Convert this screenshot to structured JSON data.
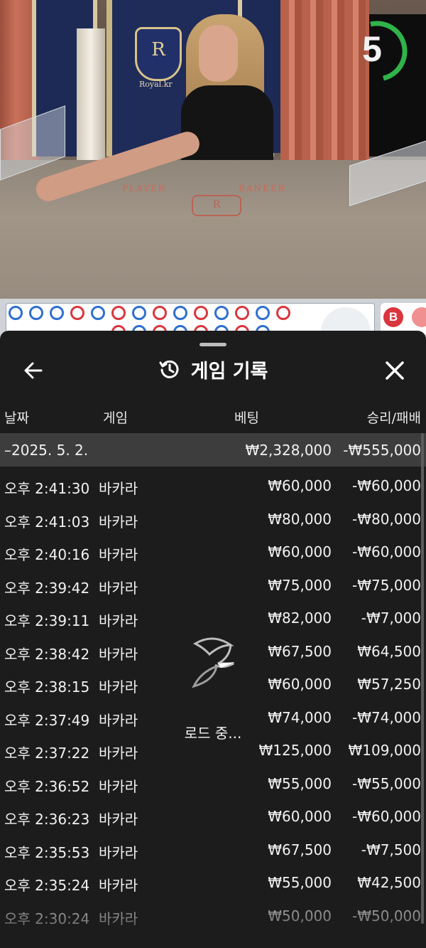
{
  "video": {
    "countdown": "5",
    "brand": "Royal.kr",
    "crest_letter": "R",
    "table_player": "PLAYER",
    "table_banker": "BANKER",
    "table_logo": "R"
  },
  "road": {
    "top_row": [
      "blue",
      "blue",
      "blue",
      "red",
      "blue",
      "red",
      "blue",
      "red",
      "blue",
      "red",
      "blue",
      "red",
      "blue",
      "red"
    ],
    "banker_badge": "B"
  },
  "sheet": {
    "title": "게임 기록",
    "columns": {
      "date": "날짜",
      "game": "게임",
      "bet": "베팅",
      "result": "승리/패배"
    },
    "date_row": {
      "date": "–2025. 5. 2.",
      "bet": "₩2,328,000",
      "result": "-₩555,000"
    },
    "rows": [
      {
        "time": "오후 2:41:30",
        "game": "바카라",
        "bet": "₩60,000",
        "result": "-₩60,000"
      },
      {
        "time": "오후 2:41:03",
        "game": "바카라",
        "bet": "₩80,000",
        "result": "-₩80,000"
      },
      {
        "time": "오후 2:40:16",
        "game": "바카라",
        "bet": "₩60,000",
        "result": "-₩60,000"
      },
      {
        "time": "오후 2:39:42",
        "game": "바카라",
        "bet": "₩75,000",
        "result": "-₩75,000"
      },
      {
        "time": "오후 2:39:11",
        "game": "바카라",
        "bet": "₩82,000",
        "result": "-₩7,000"
      },
      {
        "time": "오후 2:38:42",
        "game": "바카라",
        "bet": "₩67,500",
        "result": "₩64,500"
      },
      {
        "time": "오후 2:38:15",
        "game": "바카라",
        "bet": "₩60,000",
        "result": "₩57,250"
      },
      {
        "time": "오후 2:37:49",
        "game": "바카라",
        "bet": "₩74,000",
        "result": "-₩74,000"
      },
      {
        "time": "오후 2:37:22",
        "game": "바카라",
        "bet": "₩125,000",
        "result": "₩109,000"
      },
      {
        "time": "오후 2:36:52",
        "game": "바카라",
        "bet": "₩55,000",
        "result": "-₩55,000"
      },
      {
        "time": "오후 2:36:23",
        "game": "바카라",
        "bet": "₩60,000",
        "result": "-₩60,000"
      },
      {
        "time": "오후 2:35:53",
        "game": "바카라",
        "bet": "₩67,500",
        "result": "-₩7,500"
      },
      {
        "time": "오후 2:35:24",
        "game": "바카라",
        "bet": "₩55,000",
        "result": "₩42,500"
      },
      {
        "time": "오후 2:30:24",
        "game": "바카라",
        "bet": "₩50,000",
        "result": "-₩50,000"
      }
    ],
    "loading_text": "로드 중..."
  },
  "colors": {
    "player_blue": "#2e6fd0",
    "banker_red": "#d9363e",
    "timer_green": "#2fb34a"
  },
  "icons": {
    "back": "arrow-left-icon",
    "history": "history-icon",
    "close": "close-icon",
    "loader": "spinner-icon"
  }
}
